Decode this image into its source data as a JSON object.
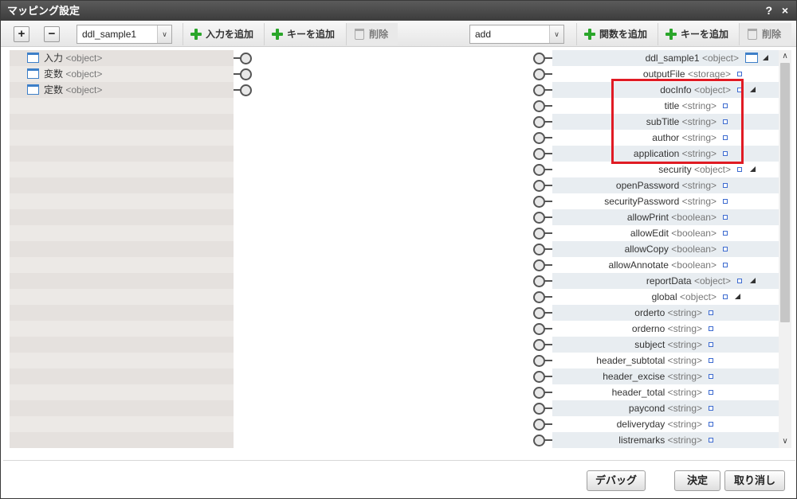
{
  "window": {
    "title": "マッピング設定",
    "help": "?",
    "close": "×"
  },
  "toolbar": {
    "expand_label": "+",
    "collapse_label": "−",
    "left_combo_value": "ddl_sample1",
    "add_input_label": "入力を追加",
    "add_key_label": "キーを追加",
    "delete_label": "削除",
    "right_combo_value": "add",
    "add_function_label": "関数を追加",
    "add_key2_label": "キーを追加",
    "delete2_label": "削除",
    "combo_arrow": "∨"
  },
  "left_tree": [
    {
      "name": "入力",
      "type": "<object>"
    },
    {
      "name": "変数",
      "type": "<object>"
    },
    {
      "name": "定数",
      "type": "<object>"
    }
  ],
  "right_tree": [
    {
      "name": "ddl_sample1",
      "type": "<object>"
    },
    {
      "name": "outputFile",
      "type": "<storage>"
    },
    {
      "name": "docInfo",
      "type": "<object>"
    },
    {
      "name": "title",
      "type": "<string>"
    },
    {
      "name": "subTitle",
      "type": "<string>"
    },
    {
      "name": "author",
      "type": "<string>"
    },
    {
      "name": "application",
      "type": "<string>"
    },
    {
      "name": "security",
      "type": "<object>"
    },
    {
      "name": "openPassword",
      "type": "<string>"
    },
    {
      "name": "securityPassword",
      "type": "<string>"
    },
    {
      "name": "allowPrint",
      "type": "<boolean>"
    },
    {
      "name": "allowEdit",
      "type": "<boolean>"
    },
    {
      "name": "allowCopy",
      "type": "<boolean>"
    },
    {
      "name": "allowAnnotate",
      "type": "<boolean>"
    },
    {
      "name": "reportData",
      "type": "<object>"
    },
    {
      "name": "global",
      "type": "<object>"
    },
    {
      "name": "orderto",
      "type": "<string>"
    },
    {
      "name": "orderno",
      "type": "<string>"
    },
    {
      "name": "subject",
      "type": "<string>"
    },
    {
      "name": "header_subtotal",
      "type": "<string>"
    },
    {
      "name": "header_excise",
      "type": "<string>"
    },
    {
      "name": "header_total",
      "type": "<string>"
    },
    {
      "name": "paycond",
      "type": "<string>"
    },
    {
      "name": "deliveryday",
      "type": "<string>"
    },
    {
      "name": "listremarks",
      "type": "<string>"
    }
  ],
  "scrollbar": {
    "up": "∧",
    "down": "∨"
  },
  "footer": {
    "debug_label": "デバッグ",
    "ok_label": "決定",
    "cancel_label": "取り消し"
  },
  "colors": {
    "highlight": "#e01b24",
    "accent": "#3d7fc8",
    "add": "#2aa62a"
  }
}
